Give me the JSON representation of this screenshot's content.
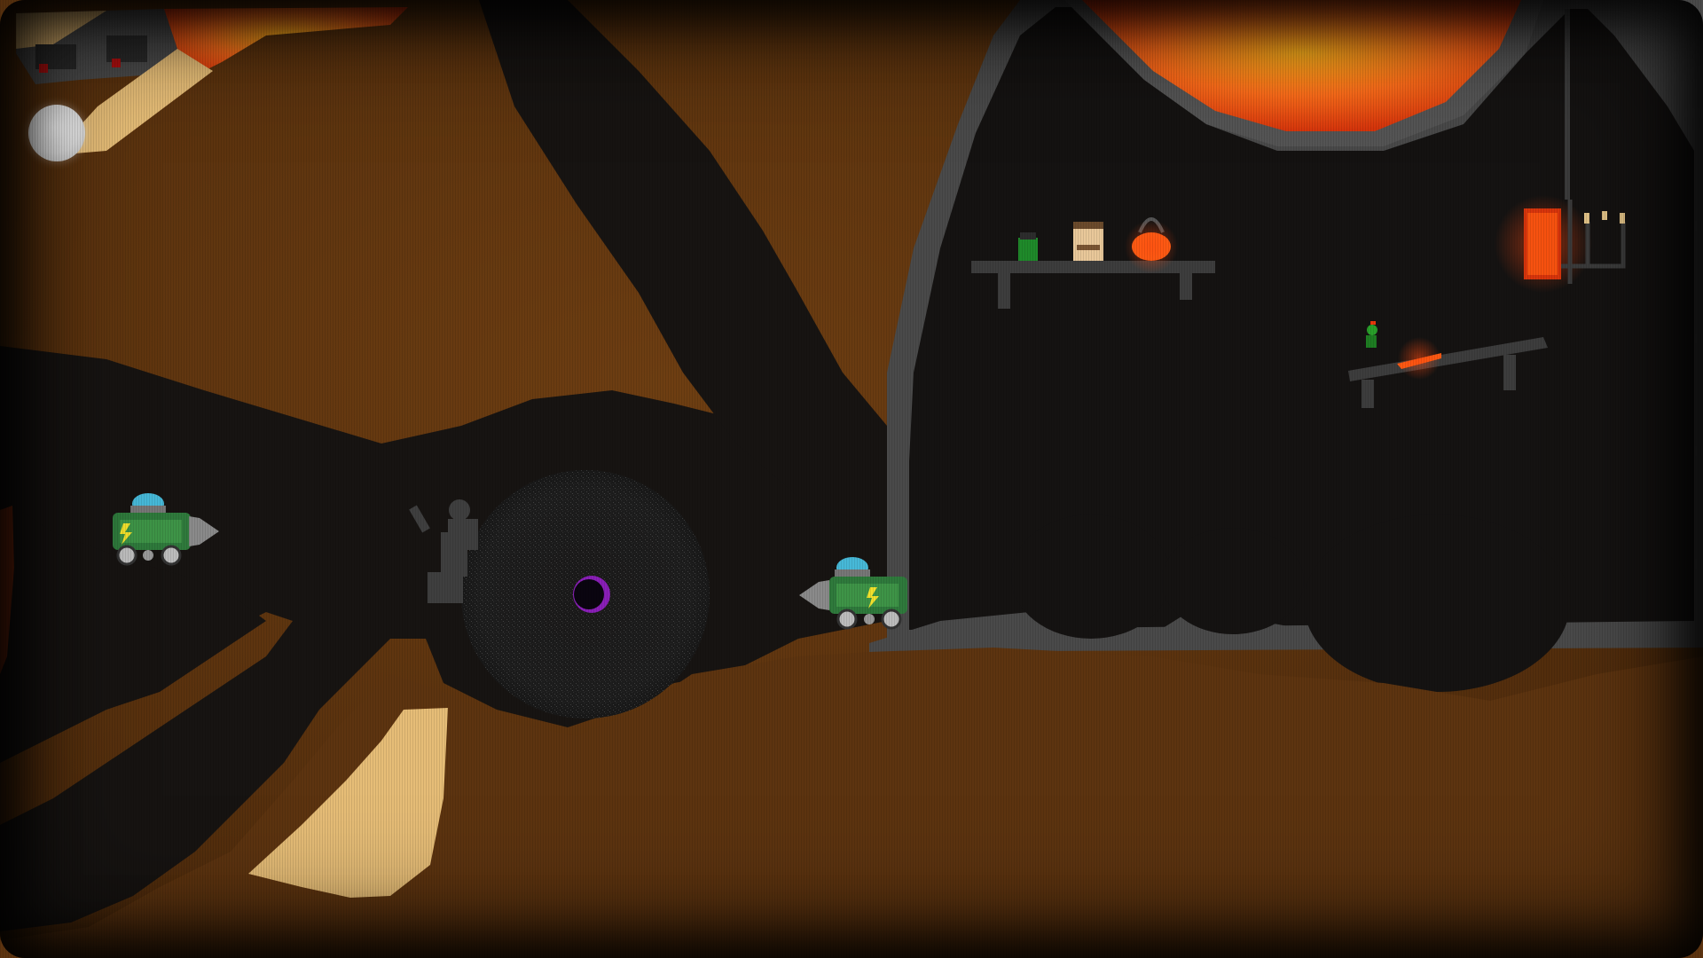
{
  "game": {
    "scene": "underground-lava-lair",
    "colors": {
      "dirt": "#6b3d12",
      "dirt_dark": "#4a2a0c",
      "tunnel": "#161311",
      "rock_gray": "#4e4e4e",
      "lava": "#ff6a1a",
      "lava_hot": "#ffb020",
      "sand": "#e7bd76",
      "drill_green": "#2f7a3c",
      "drill_dome": "#47b9d8",
      "portal_purple": "#8a1fb8"
    },
    "hud": {
      "pause_button_icon": "circle-button-icon"
    },
    "players": [
      {
        "name": "drill-vehicle-left",
        "facing": "right",
        "icon": "drill-tank-icon"
      },
      {
        "name": "drill-vehicle-right",
        "facing": "left",
        "icon": "drill-tank-icon"
      }
    ],
    "props": [
      "green-potion-jar",
      "honey-jar",
      "lava-cauldron",
      "candelabra",
      "lava-chest",
      "gray-statue",
      "black-hole-portal"
    ]
  }
}
